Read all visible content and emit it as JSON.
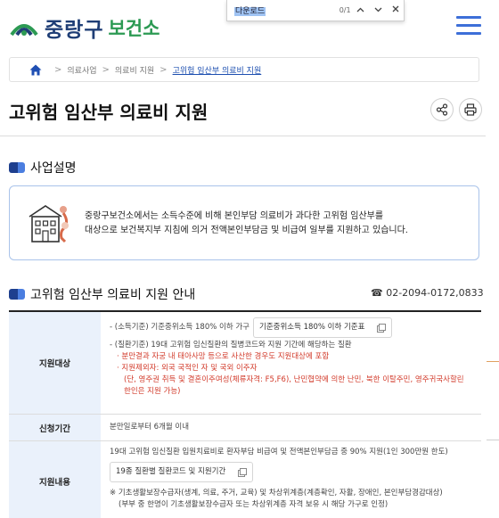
{
  "header": {
    "logo_main": "중랑구",
    "logo_sub": "보건소"
  },
  "findbar": {
    "query": "다운로드",
    "count": "0/1",
    "prev_icon": "chevron-up",
    "next_icon": "chevron-down",
    "close_icon": "close"
  },
  "breadcrumb": {
    "items": [
      "의료사업",
      "의료비 지원",
      "고위험 임산부 의료비 지원"
    ]
  },
  "page": {
    "title": "고위험 임산부 의료비 지원"
  },
  "section1": {
    "title": "사업설명",
    "text_line1": "중랑구보건소에서는 소득수준에 비해 본인부담 의료비가 과다한 고위험 임산부를",
    "text_line2": "대상으로 보건복지부 지침에 의거 전액본인부담금 및 비급여 일부를 지원하고 있습니다."
  },
  "section2": {
    "title": "고위험 임산부 의료비 지원 안내",
    "phone": "☎ 02-2094-0172,0833"
  },
  "table": {
    "target": {
      "label": "지원대상",
      "l1_text": "- (소득기준) 기준중위소득 180% 이하 가구",
      "l1_chip": "기준중위소득 180% 이하 기준표",
      "l2": "- (질환기준) 19대 고위험 임신질환의 질병코드와 지원 기간에 해당하는 질환",
      "l3": "· 분만결과 자궁 내 태아사망 등으로 사산한 경우도 지원대상에 포함",
      "l4": "· 지원제외자: 외국 국적인 자 및 국외 이주자",
      "l5": "(단, 영주권 취득 및 결혼이주여성(체류자격: F5,F6), 난민협약에 의한 난민, 북한 이탈주민, 영주귀국사할린 한인은 지원 가능)"
    },
    "period": {
      "label": "신청기간",
      "text": "분만일로부터 6개월 이내"
    },
    "content": {
      "label": "지원내용",
      "l1": "19대 고위험 임신질환 입원치료비로 환자부담 비급여 및 전액본인부담금 중 90% 지원(1인 300만원 한도)",
      "chip": "19종 질환별 질환코드 및 지원기간",
      "l2": "※ 기초생활보장수급자(생계, 의료, 주거, 교육) 및 차상위계층(계층확인, 자활, 장애인, 본인부담경감대상)",
      "l3": "(부부 중 한명이 기초생활보장수급자 또는 차상위계층 자격 보유 시 해당 가구로 인정)"
    }
  },
  "colors": {
    "brand_navy": "#1f3e76",
    "brand_green": "#2c9a53",
    "accent_blue": "#3d6fd8",
    "table_header_bg": "#eaf1fb",
    "warning_red": "#d23a2a"
  }
}
